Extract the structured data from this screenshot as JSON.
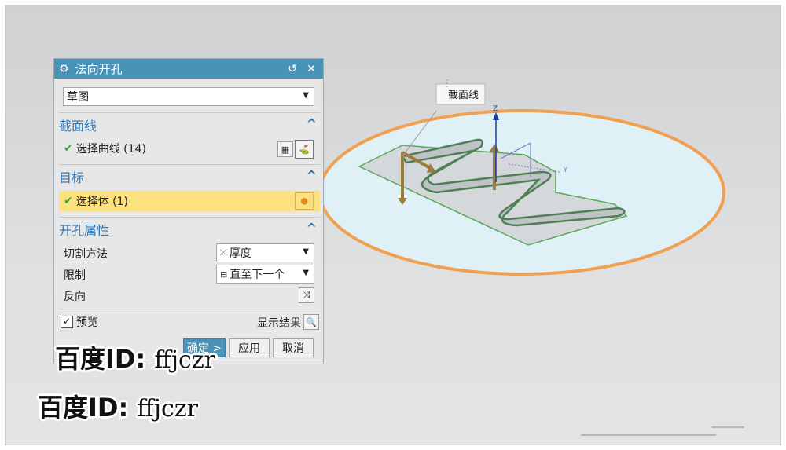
{
  "dialog": {
    "title": "法向开孔",
    "reset_icon": "reset-icon",
    "close_icon": "close-icon",
    "type_select": "草图",
    "section_curve": {
      "header": "截面线",
      "select_label": "选择曲线 (14)"
    },
    "target": {
      "header": "目标",
      "select_label": "选择体 (1)"
    },
    "hole_props": {
      "header": "开孔属性",
      "cut_method_label": "切割方法",
      "cut_method_value": "厚度",
      "limit_label": "限制",
      "limit_value": "直至下一个",
      "reverse_label": "反向"
    },
    "preview_label": "预览",
    "preview_checked": true,
    "show_result_label": "显示结果",
    "ok_label": "确定 >",
    "apply_label": "应用",
    "cancel_label": "取消"
  },
  "viewport": {
    "callout_label": "截面线",
    "axis_z": "Z",
    "axis_y": "Y"
  },
  "watermark": {
    "line1_prefix": "百度ID:",
    "line1_id": "ffjczr",
    "line2_prefix": "百度ID:",
    "line2_id": "ffjczr"
  },
  "colors": {
    "titlebar": "#4a93b8",
    "section_header": "#2f76b5",
    "highlight": "#fde07f",
    "disk_fill": "#dff1f7",
    "disk_edge": "#f0a050"
  }
}
